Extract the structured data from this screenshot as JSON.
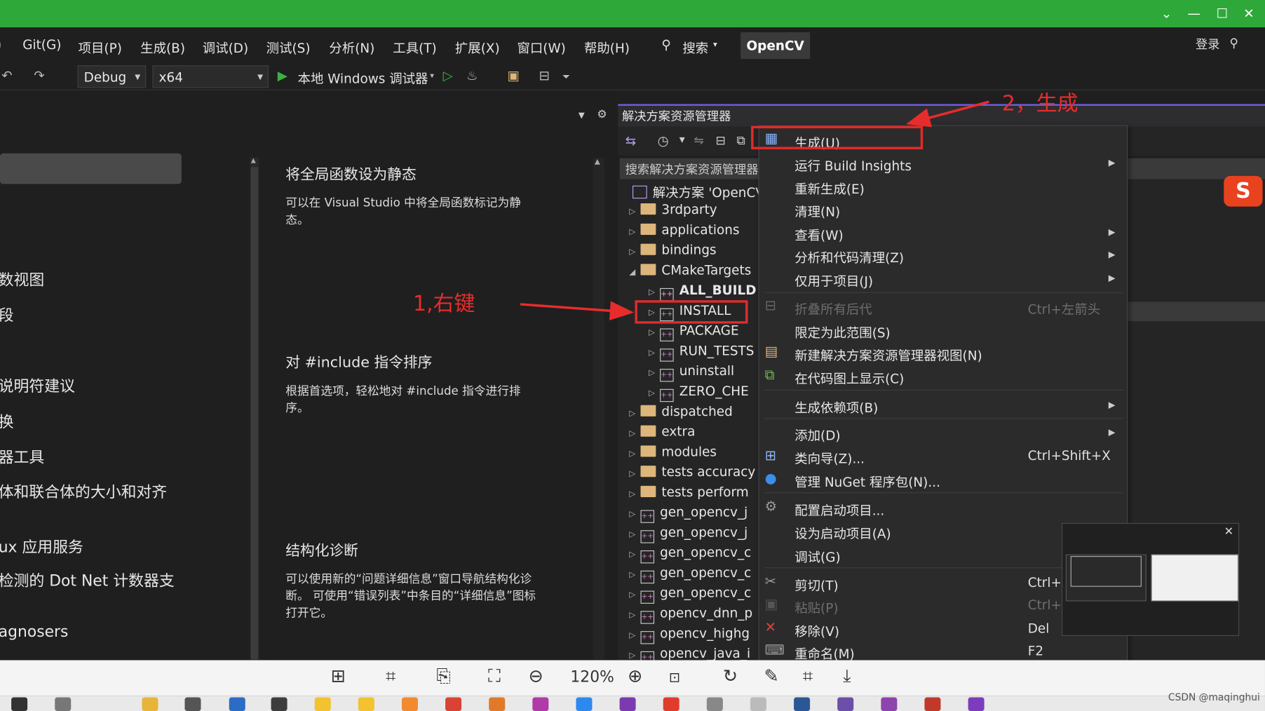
{
  "titlebar": {
    "min": "—",
    "max": "☐",
    "close": "✕",
    "chev": "⌄"
  },
  "menubar": {
    "items": [
      "Git(G)",
      "项目(P)",
      "生成(B)",
      "调试(D)",
      "测试(S)",
      "分析(N)",
      "工具(T)",
      "扩展(X)",
      "窗口(W)",
      "帮助(H)"
    ],
    "search": "搜索",
    "project": "OpenCV",
    "login": "登录"
  },
  "toolbar": {
    "config": "Debug",
    "platform": "x64",
    "run": "本地 Windows 调试器"
  },
  "left": {
    "items": [
      "数视图",
      "段",
      "说明符建议",
      "换",
      "器工具",
      "体和联合体的大小和对齐",
      "ux 应用服务",
      "检测的 Dot Net 计数器支",
      "agnosers"
    ]
  },
  "tips": [
    {
      "title": "将全局函数设为静态",
      "desc": "可以在 Visual Studio 中将全局函数标记为静态。"
    },
    {
      "title": "对 #include 指令排序",
      "desc": "根据首选项，轻松地对 #include 指令进行排序。"
    },
    {
      "title": "结构化诊断",
      "desc": "可以使用新的“问题详细信息”窗口导航结构化诊断。 可使用“错误列表”中条目的“详细信息”图标打开它。"
    }
  ],
  "solution_explorer": {
    "title": "解决方案资源管理器",
    "search_placeholder": "搜索解决方案资源管理器",
    "solution": "解决方案 'OpenCV",
    "rows": [
      "3rdparty",
      "applications",
      "bindings",
      "CMakeTargets",
      "ALL_BUILD",
      "INSTALL",
      "PACKAGE",
      "RUN_TESTS",
      "uninstall",
      "ZERO_CHE",
      "dispatched",
      "extra",
      "modules",
      "tests accuracy",
      "tests perform",
      "gen_opencv_j",
      "gen_opencv_j",
      "gen_opencv_c",
      "gen_opencv_c",
      "gen_opencv_c",
      "opencv_dnn_p",
      "opencv_highg",
      "opencv_java_i"
    ]
  },
  "context_menu": {
    "items": [
      {
        "label": "生成(U)"
      },
      {
        "label": "运行 Build Insights"
      },
      {
        "label": "重新生成(E)"
      },
      {
        "label": "清理(N)"
      },
      {
        "label": "查看(W)"
      },
      {
        "label": "分析和代码清理(Z)"
      },
      {
        "label": "仅用于项目(J)"
      },
      {
        "label": "折叠所有后代",
        "shortcut": "Ctrl+左箭头"
      },
      {
        "label": "限定为此范围(S)"
      },
      {
        "label": "新建解决方案资源管理器视图(N)"
      },
      {
        "label": "在代码图上显示(C)"
      },
      {
        "label": "生成依赖项(B)"
      },
      {
        "label": "添加(D)"
      },
      {
        "label": "类向导(Z)...",
        "shortcut": "Ctrl+Shift+X"
      },
      {
        "label": "管理 NuGet 程序包(N)..."
      },
      {
        "label": "配置启动项目..."
      },
      {
        "label": "设为启动项目(A)"
      },
      {
        "label": "调试(G)"
      },
      {
        "label": "剪切(T)",
        "shortcut": "Ctrl+X"
      },
      {
        "label": "粘贴(P)",
        "shortcut": "Ctrl+V"
      },
      {
        "label": "移除(V)",
        "shortcut": "Del"
      },
      {
        "label": "重命名(M)",
        "shortcut": "F2"
      }
    ]
  },
  "annotations": {
    "a1": "1,右键",
    "a2": "2，生成"
  },
  "viewer": {
    "zoom": "120%"
  },
  "watermark": "CSDN @maqinghui",
  "colors": {
    "titlebar": "#2fa83a",
    "accent": "#7160e8",
    "annotation": "#e82c2c"
  }
}
